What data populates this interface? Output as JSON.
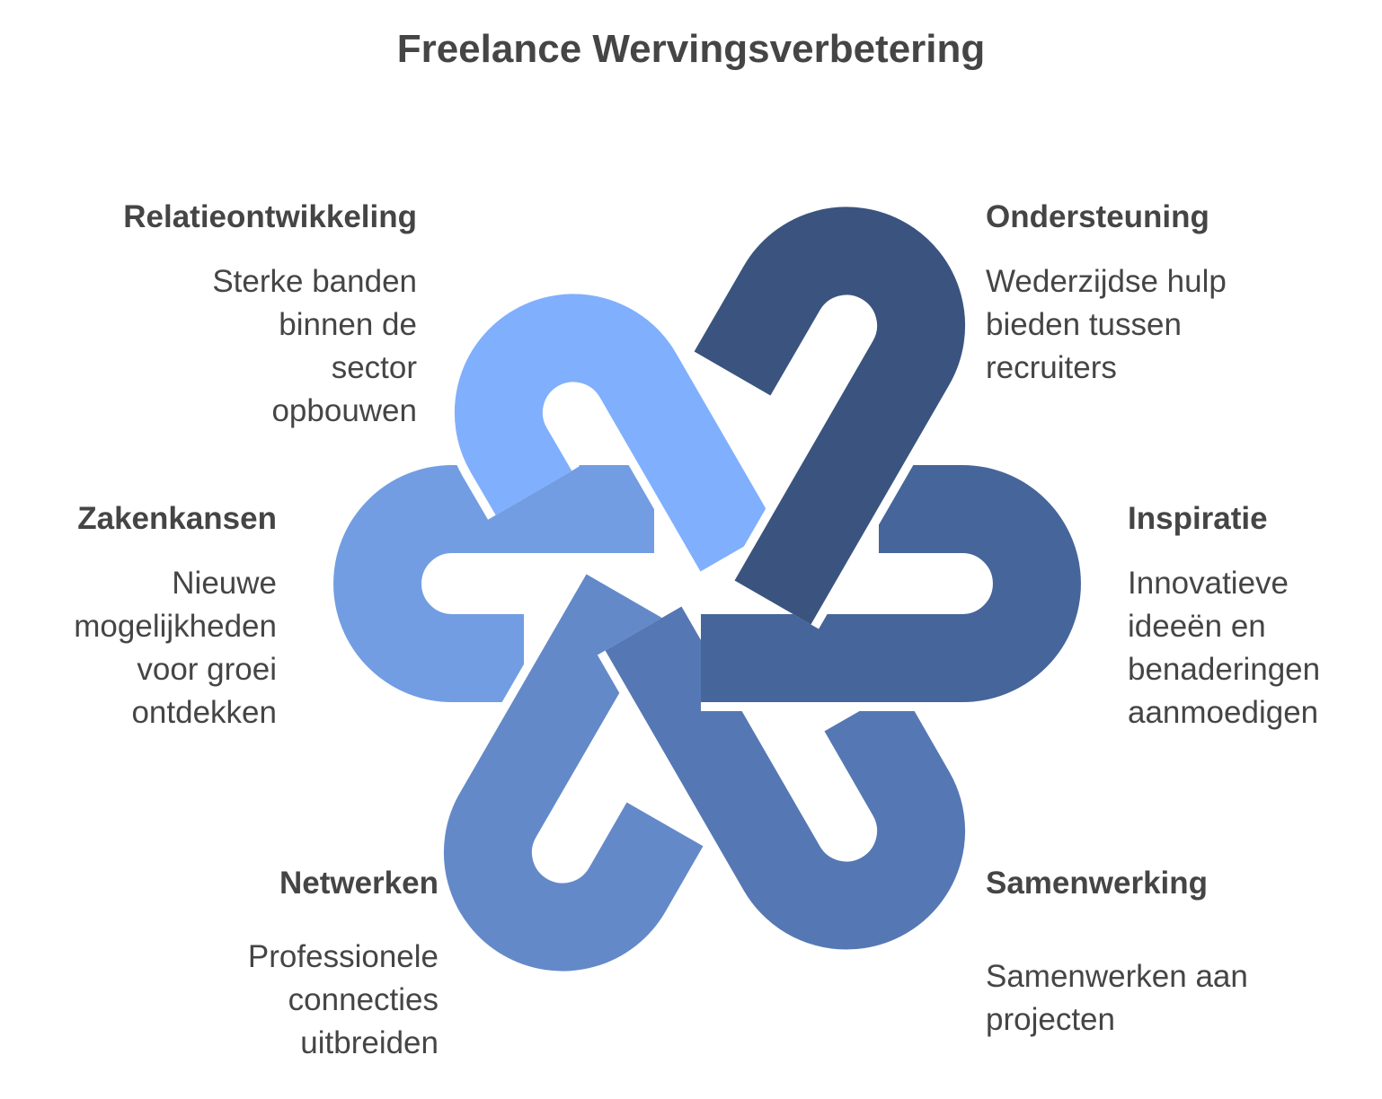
{
  "title": "Freelance Wervingsverbetering",
  "items": [
    {
      "key": "relatieontwikkeling",
      "heading": "Relatieontwikkeling",
      "description": "Sterke banden binnen de sector opbouwen",
      "color": "#80AFFD"
    },
    {
      "key": "ondersteuning",
      "heading": "Ondersteuning",
      "description": "Wederzijdse hulp bieden tussen recruiters",
      "color": "#3A547F"
    },
    {
      "key": "zakenkansen",
      "heading": "Zakenkansen",
      "description": "Nieuwe mogelijkheden voor groei ontdekken",
      "color": "#729DE3"
    },
    {
      "key": "inspiratie",
      "heading": "Inspiratie",
      "description": "Innovatieve ideeën en benaderingen aanmoedigen",
      "color": "#46659A"
    },
    {
      "key": "netwerken",
      "heading": "Netwerken",
      "description": "Professionele connecties uitbreiden",
      "color": "#6389C9"
    },
    {
      "key": "samenwerking",
      "heading": "Samenwerking",
      "description": "Samenwerken aan projecten",
      "color": "#5578B4"
    }
  ]
}
